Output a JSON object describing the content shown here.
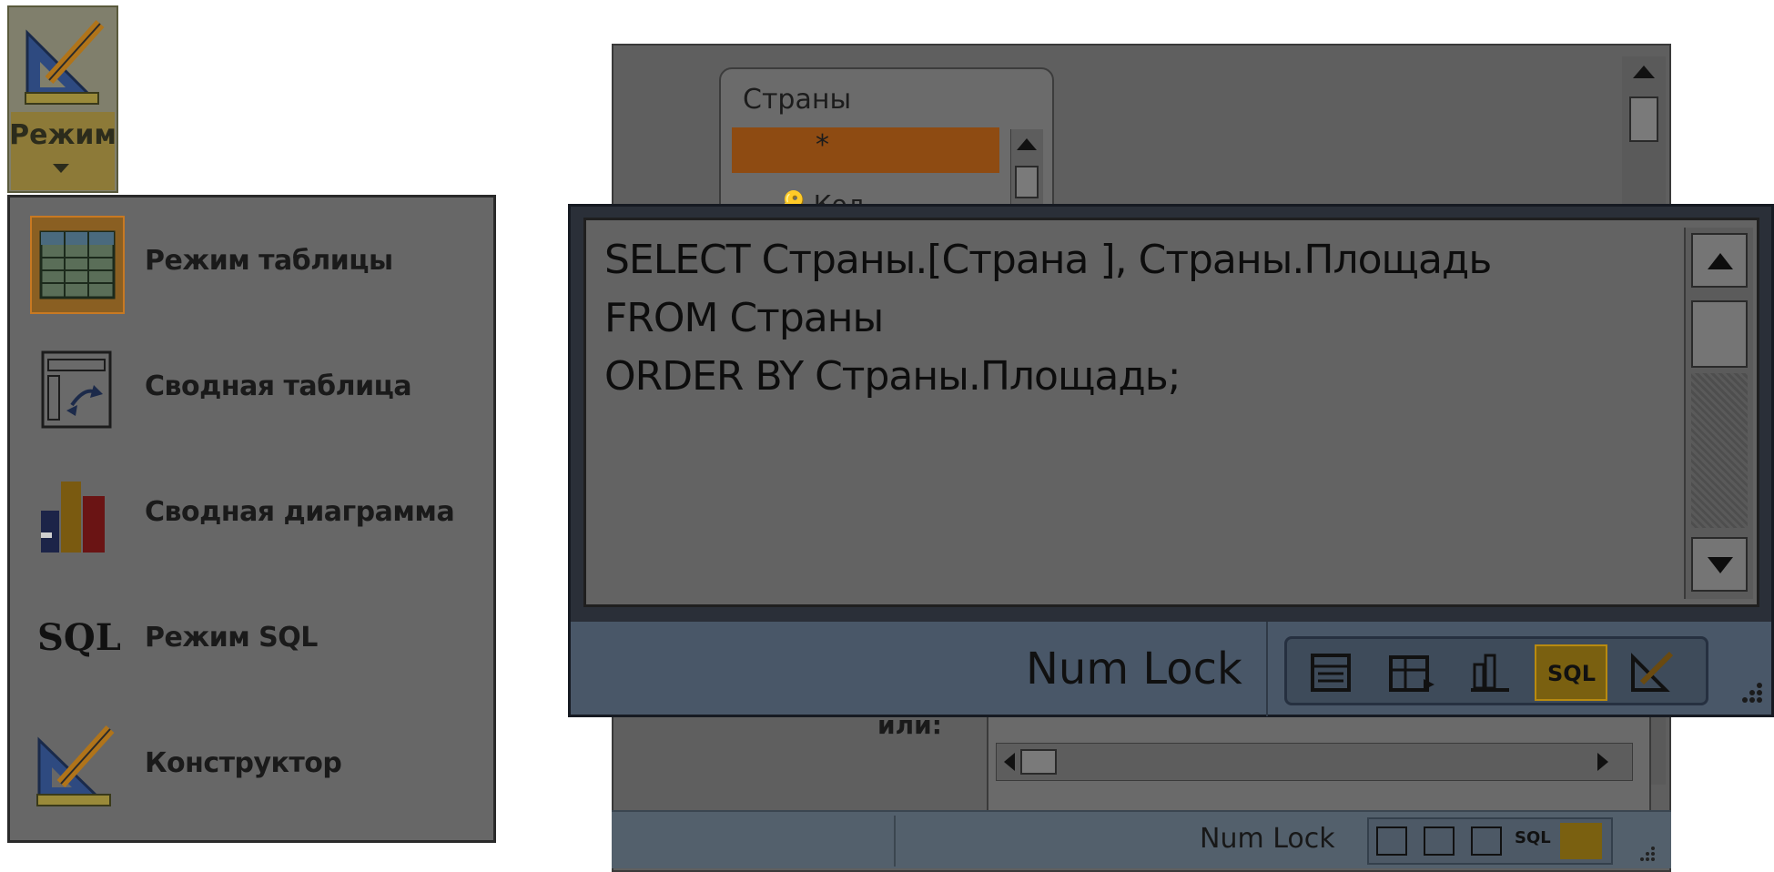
{
  "ribbon": {
    "mode_button_label": "Режим"
  },
  "menu": {
    "items": [
      {
        "label": "Режим таблицы",
        "icon": "datasheet-view-icon",
        "active": true
      },
      {
        "label": "Сводная таблица",
        "icon": "pivot-table-icon",
        "active": false
      },
      {
        "label": "Сводная диаграмма",
        "icon": "pivot-chart-icon",
        "active": false
      },
      {
        "label": "Режим SQL",
        "icon": "sql-view-icon",
        "active": false,
        "icon_text": "SQL"
      },
      {
        "label": "Конструктор",
        "icon": "design-view-icon",
        "active": false
      }
    ]
  },
  "query_designer": {
    "table_title": "Страны",
    "fields": [
      "*",
      "Код"
    ],
    "criteria_label": "или:"
  },
  "sql_editor": {
    "lines": [
      "SELECT Страны.[Страна ], Страны.Площадь",
      "FROM Страны",
      "ORDER BY Страны.Площадь;"
    ]
  },
  "status_bar": {
    "numlock": "Num Lock",
    "view_buttons": [
      "datasheet-view-icon",
      "pivot-table-icon",
      "pivot-chart-icon",
      "sql-view-icon",
      "design-view-icon"
    ],
    "active_view": "sql-view-icon",
    "sql_button_text": "SQL"
  },
  "colors": {
    "menu_bg": "#676767",
    "active_orange": "#c87922",
    "status_blue": "#495768"
  }
}
